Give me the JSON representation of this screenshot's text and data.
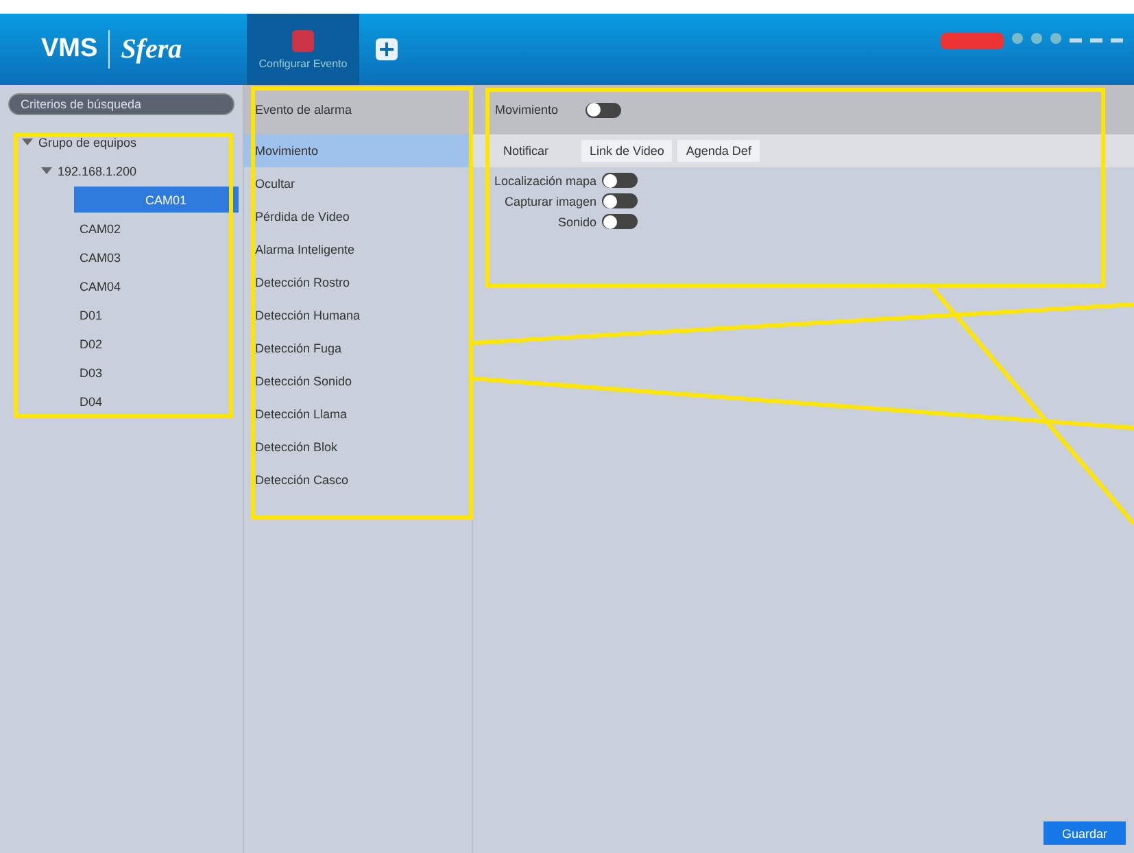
{
  "app": {
    "logo_left": "VMS",
    "logo_right": "Sfera"
  },
  "top_tabs": [
    {
      "label": "Configurar Evento",
      "selected": true,
      "kind": "event"
    },
    {
      "selected": false,
      "kind": "add"
    }
  ],
  "sidebar": {
    "search": {
      "placeholder": "Criterios de búsqueda"
    },
    "tree": [
      {
        "label": "Grupo de equipos",
        "expanded": true,
        "children": [
          {
            "label": "192.168.1.200",
            "expanded": true,
            "children": [
              {
                "label": "CAM01",
                "selected": true
              },
              {
                "label": "CAM02",
                "selected": false
              },
              {
                "label": "CAM03",
                "selected": false
              },
              {
                "label": "CAM04",
                "selected": false
              },
              {
                "label": "D01",
                "selected": false
              },
              {
                "label": "D02",
                "selected": false
              },
              {
                "label": "D03",
                "selected": false
              },
              {
                "label": "D04",
                "selected": false
              }
            ]
          }
        ]
      }
    ]
  },
  "events": {
    "header": "Evento de alarma",
    "items": [
      {
        "label": "Movimiento",
        "selected": true
      },
      {
        "label": "Ocultar",
        "selected": false
      },
      {
        "label": "Pérdida de Video",
        "selected": false
      },
      {
        "label": "Alarma Inteligente",
        "selected": false
      },
      {
        "label": "Detección Rostro",
        "selected": false
      },
      {
        "label": "Detección Humana",
        "selected": false
      },
      {
        "label": "Detección Fuga",
        "selected": false
      },
      {
        "label": "Detección Sonido",
        "selected": false
      },
      {
        "label": "Detección Llama",
        "selected": false
      },
      {
        "label": "Detección Blok",
        "selected": false
      },
      {
        "label": "Detección Casco",
        "selected": false
      }
    ]
  },
  "detail": {
    "enable": {
      "label": "Movimiento",
      "on": false
    },
    "tabs": [
      {
        "label": "Notificar",
        "selected": true
      },
      {
        "label": "Link de Video",
        "selected": false
      },
      {
        "label": "Agenda Def",
        "selected": false
      }
    ],
    "options": [
      {
        "label": "Localización mapa",
        "on": false
      },
      {
        "label": "Capturar imagen",
        "on": false
      },
      {
        "label": "Sonido",
        "on": false
      }
    ]
  },
  "save_button": "Guardar"
}
